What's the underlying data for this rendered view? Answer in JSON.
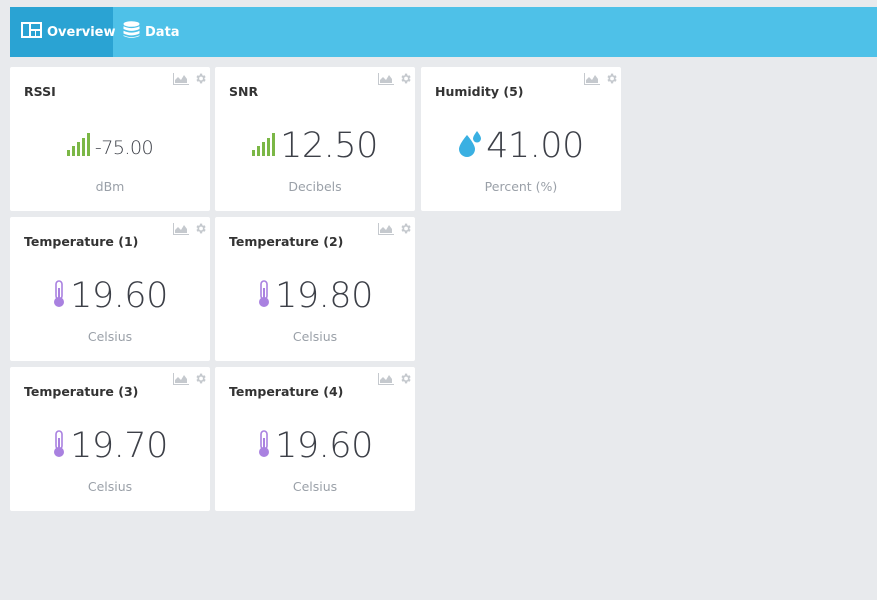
{
  "tabs": [
    {
      "label": "Overview",
      "active": true,
      "icon": "dashboard-icon"
    },
    {
      "label": "Data",
      "active": false,
      "icon": "database-icon"
    }
  ],
  "colors": {
    "topbar": "#4ec1e8",
    "tab_active": "#2aa3d3",
    "signal": "#7bb746",
    "humidity": "#3ab0e2",
    "thermometer": "#a981e0"
  },
  "widgets": [
    {
      "title": "RSSI",
      "value": "-75.00",
      "unit": "dBm",
      "icon": "signal-icon"
    },
    {
      "title": "SNR",
      "value": "12.50",
      "unit": "Decibels",
      "icon": "signal-icon"
    },
    {
      "title": "Humidity (5)",
      "value": "41.00",
      "unit": "Percent (%)",
      "icon": "water-drops-icon"
    },
    {
      "title": "Temperature (1)",
      "value": "19.60",
      "unit": "Celsius",
      "icon": "thermometer-icon"
    },
    {
      "title": "Temperature (2)",
      "value": "19.80",
      "unit": "Celsius",
      "icon": "thermometer-icon"
    },
    {
      "title": "Temperature (3)",
      "value": "19.70",
      "unit": "Celsius",
      "icon": "thermometer-icon"
    },
    {
      "title": "Temperature (4)",
      "value": "19.60",
      "unit": "Celsius",
      "icon": "thermometer-icon"
    }
  ]
}
